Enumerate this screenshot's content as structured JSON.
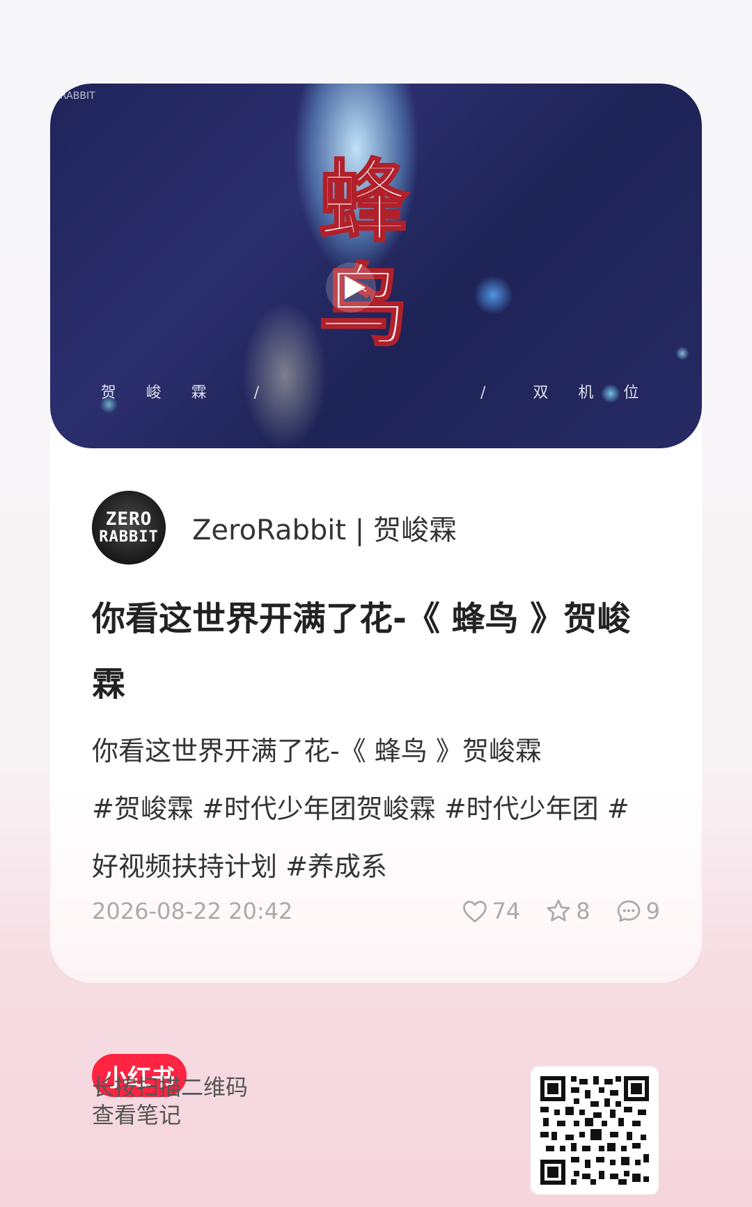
{
  "cover": {
    "watermark": "RABBIT",
    "big_title_line1": "蜂",
    "big_title_line2": "鸟",
    "subtitle": "贺 峻 霖  /            /  双 机 位"
  },
  "author": {
    "avatar_line1": "ZERO",
    "avatar_line2": "RABBIT",
    "name": "ZeroRabbit | 贺峻霖"
  },
  "note": {
    "title": "你看这世界开满了花-《 蜂鸟 》贺峻霖",
    "desc_line1": "你看这世界开满了花-《 蜂鸟 》贺峻霖",
    "desc_tags": "#贺峻霖 #时代少年团贺峻霖 #时代少年团 #好视频扶持计划  #养成系",
    "date": "2026-08-22 20:42",
    "likes": "74",
    "stars": "8",
    "comments": "9"
  },
  "footer": {
    "logo": "小红书",
    "line1": "长按扫描二维码",
    "line2": "查看笔记"
  },
  "colors": {
    "brand": "#ff2442",
    "meta_gray": "#aaaaaa"
  },
  "icons": {
    "like": "heart-icon",
    "star": "star-icon",
    "comment": "comment-icon",
    "play": "play-icon"
  }
}
